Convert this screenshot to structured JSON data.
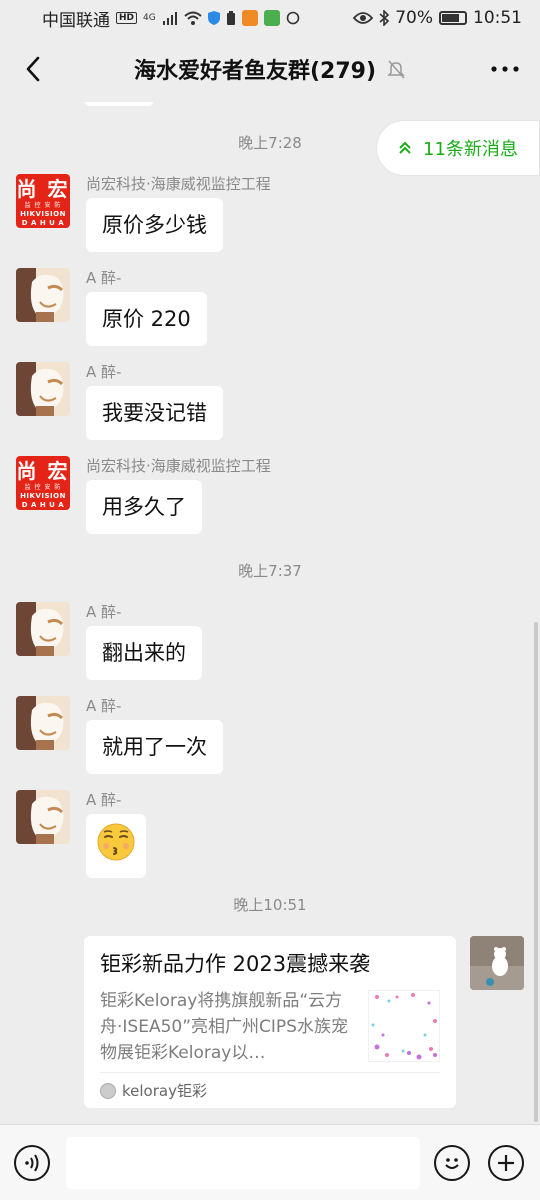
{
  "status_bar": {
    "carrier": "中国联通",
    "hd": "HD",
    "network": "4G",
    "battery": "70%",
    "battery_level": 0.7,
    "time": "10:51"
  },
  "header": {
    "title": "海水爱好者鱼友群(279)",
    "icons": [
      "back-arrow-icon",
      "mute-bell-icon",
      "more-icon"
    ]
  },
  "new_messages": {
    "label": "11条新消息",
    "icon": "double-chevron-up-icon",
    "color": "#1aad19"
  },
  "timestamps": [
    "晚上7:28",
    "晚上7:37",
    "晚上10:51"
  ],
  "messages": [
    {
      "sender": "尚宏科技·海康威视监控工程",
      "text": "原价多少钱",
      "avatar": "shanghong"
    },
    {
      "sender": "A 醉-",
      "text": "原价 220",
      "avatar": "cat"
    },
    {
      "sender": "A 醉-",
      "text": "我要没记错",
      "avatar": "cat"
    },
    {
      "sender": "尚宏科技·海康威视监控工程",
      "text": "用多久了",
      "avatar": "shanghong"
    },
    {
      "sender": "A 醉-",
      "text": "翻出来的",
      "avatar": "cat"
    },
    {
      "sender": "A 醉-",
      "text": "就用了一次",
      "avatar": "cat"
    },
    {
      "sender": "A 醉-",
      "text": "😚",
      "avatar": "cat"
    }
  ],
  "avatar_shanghong": {
    "line1": "尚 宏",
    "line2": "监 控 安 防",
    "line3": "HIKVISION",
    "line4": "D A H U A"
  },
  "link_card": {
    "title": "钜彩新品力作 2023震撼来袭",
    "description": "钜彩Keloray将携旗舰新品“云方舟·ISEA50”亮相广州CIPS水族宠物展钜彩Keloray以…",
    "source": "keloray钜彩"
  },
  "input_bar": {
    "icons": [
      "voice-icon",
      "emoji-icon",
      "plus-icon"
    ]
  }
}
